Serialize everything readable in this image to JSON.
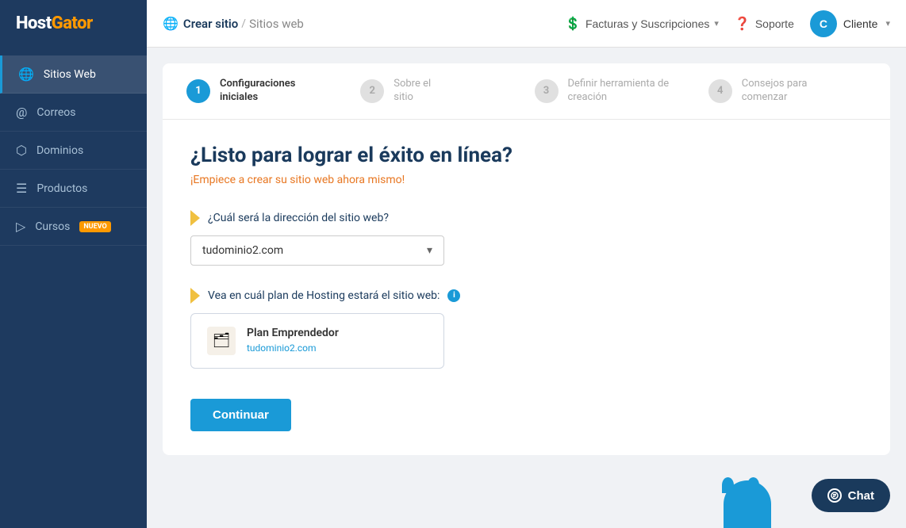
{
  "logo": {
    "text_host": "Host",
    "text_gator": "Gator"
  },
  "header": {
    "breadcrumb_current": "Crear sitio",
    "breadcrumb_sep": "/",
    "breadcrumb_parent": "Sitios web",
    "billing_label": "Facturas y Suscripciones",
    "support_label": "Soporte",
    "client_label": "Cliente",
    "client_initial": "C"
  },
  "sidebar": {
    "items": [
      {
        "id": "sitios-web",
        "label": "Sitios Web",
        "icon": "⊞",
        "active": true
      },
      {
        "id": "correos",
        "label": "Correos",
        "icon": "◎",
        "active": false
      },
      {
        "id": "dominios",
        "label": "Dominios",
        "icon": "▣",
        "active": false
      },
      {
        "id": "productos",
        "label": "Productos",
        "icon": "≡",
        "active": false
      },
      {
        "id": "cursos",
        "label": "Cursos",
        "icon": "▷",
        "active": false,
        "badge": "NUEVO"
      }
    ]
  },
  "steps": [
    {
      "num": "1",
      "label": "Configuraciones\niniciales",
      "active": true
    },
    {
      "num": "2",
      "label": "Sobre el\nsitio",
      "active": false
    },
    {
      "num": "3",
      "label": "Definir herramienta de\ncreación",
      "active": false
    },
    {
      "num": "4",
      "label": "Consejos para\ncomenzar",
      "active": false
    }
  ],
  "wizard": {
    "title": "¿Listo para lograr el éxito en línea?",
    "subtitle": "¡Empiece a crear su sitio web ahora mismo!",
    "domain_label": "¿Cuál será la dirección del sitio web?",
    "domain_value": "tudominio2.com",
    "plan_label": "Vea en cuál plan de Hosting estará el sitio web:",
    "plan_name": "Plan Emprendedor",
    "plan_domain": "tudominio2.com",
    "continue_label": "Continuar"
  },
  "chat": {
    "label": "Chat"
  }
}
